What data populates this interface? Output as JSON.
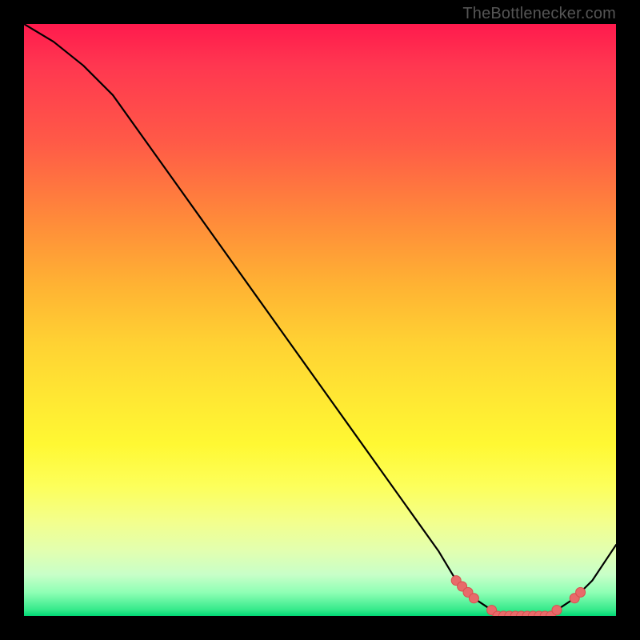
{
  "watermark": "TheBottlenecker.com",
  "colors": {
    "curve": "#000000",
    "marker_fill": "#e86a6a",
    "marker_stroke": "#d94e4e",
    "background_frame": "#000000"
  },
  "chart_data": {
    "type": "line",
    "title": "",
    "xlabel": "",
    "ylabel": "",
    "xlim": [
      0,
      100
    ],
    "ylim": [
      0,
      100
    ],
    "series": [
      {
        "name": "bottleneck-curve",
        "x": [
          0,
          5,
          10,
          15,
          20,
          25,
          30,
          35,
          40,
          45,
          50,
          55,
          60,
          65,
          70,
          73,
          76,
          79,
          82,
          85,
          88,
          90,
          93,
          96,
          100
        ],
        "y": [
          100,
          97,
          93,
          88,
          81,
          74,
          67,
          60,
          53,
          46,
          39,
          32,
          25,
          18,
          11,
          6,
          3,
          1,
          0,
          0,
          0,
          1,
          3,
          6,
          12
        ]
      }
    ],
    "markers": [
      {
        "x": 73,
        "y": 6
      },
      {
        "x": 74,
        "y": 5
      },
      {
        "x": 75,
        "y": 4
      },
      {
        "x": 76,
        "y": 3
      },
      {
        "x": 79,
        "y": 1
      },
      {
        "x": 80,
        "y": 0
      },
      {
        "x": 81,
        "y": 0
      },
      {
        "x": 82,
        "y": 0
      },
      {
        "x": 83,
        "y": 0
      },
      {
        "x": 84,
        "y": 0
      },
      {
        "x": 85,
        "y": 0
      },
      {
        "x": 86,
        "y": 0
      },
      {
        "x": 87,
        "y": 0
      },
      {
        "x": 88,
        "y": 0
      },
      {
        "x": 89,
        "y": 0
      },
      {
        "x": 90,
        "y": 1
      },
      {
        "x": 93,
        "y": 3
      },
      {
        "x": 94,
        "y": 4
      }
    ],
    "gradient_stops": [
      {
        "pos": 0,
        "color": "#ff1a4d"
      },
      {
        "pos": 20,
        "color": "#ff5a47"
      },
      {
        "pos": 44,
        "color": "#ffb233"
      },
      {
        "pos": 71,
        "color": "#fff833"
      },
      {
        "pos": 93,
        "color": "#c8ffc8"
      },
      {
        "pos": 100,
        "color": "#00d775"
      }
    ]
  }
}
